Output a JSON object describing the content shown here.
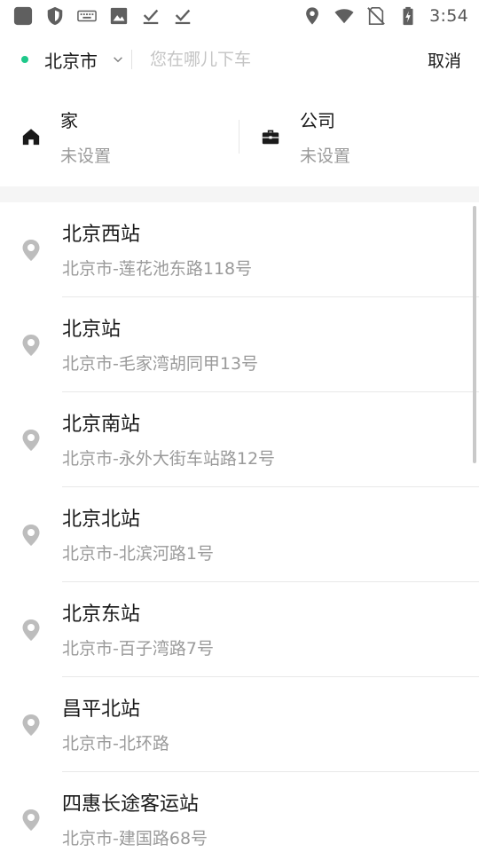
{
  "status_bar": {
    "time": "3:54",
    "left_icons": [
      "app-icon",
      "shield-icon",
      "keyboard-icon",
      "image-icon",
      "download-done-icon",
      "download-done-icon"
    ],
    "right_icons": [
      "location-icon",
      "wifi-icon",
      "no-sim-icon",
      "battery-charging-icon"
    ]
  },
  "search": {
    "city": "北京市",
    "placeholder": "您在哪儿下车",
    "value": "",
    "cancel_label": "取消",
    "accent_color": "#1ec88a"
  },
  "shortcuts": {
    "home": {
      "title": "家",
      "subtitle": "未设置",
      "icon": "home-icon"
    },
    "work": {
      "title": "公司",
      "subtitle": "未设置",
      "icon": "briefcase-icon"
    }
  },
  "places": [
    {
      "name": "北京西站",
      "address": "北京市-莲花池东路118号"
    },
    {
      "name": "北京站",
      "address": "北京市-毛家湾胡同甲13号"
    },
    {
      "name": "北京南站",
      "address": "北京市-永外大街车站路12号"
    },
    {
      "name": "北京北站",
      "address": "北京市-北滨河路1号"
    },
    {
      "name": "北京东站",
      "address": "北京市-百子湾路7号"
    },
    {
      "name": "昌平北站",
      "address": "北京市-北环路"
    },
    {
      "name": "四惠长途客运站",
      "address": "北京市-建国路68号"
    }
  ]
}
